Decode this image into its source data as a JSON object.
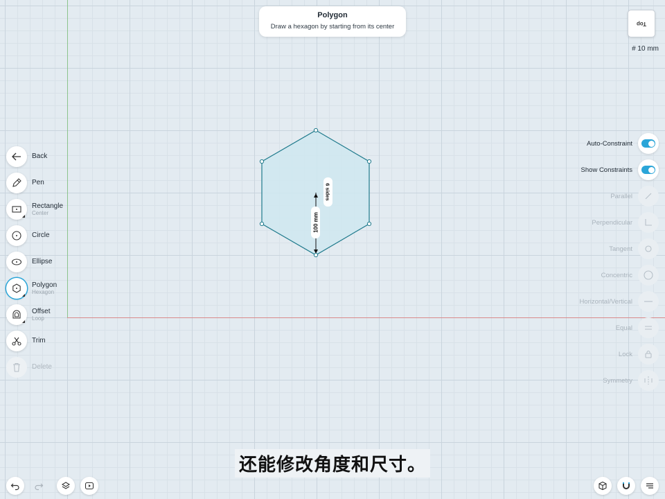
{
  "hint": {
    "title": "Polygon",
    "subtitle": "Draw a hexagon by starting from its center"
  },
  "viewcube": {
    "label": "Top"
  },
  "grid_size": "# 10 mm",
  "tools": [
    {
      "label": "Back",
      "icon": "back-arrow-icon"
    },
    {
      "label": "Pen",
      "icon": "pen-icon"
    },
    {
      "label": "Rectangle",
      "sublabel": "Center",
      "icon": "rectangle-icon"
    },
    {
      "label": "Circle",
      "icon": "circle-icon"
    },
    {
      "label": "Ellipse",
      "icon": "ellipse-icon"
    },
    {
      "label": "Polygon",
      "sublabel": "Hexagon",
      "icon": "polygon-icon",
      "active": true
    },
    {
      "label": "Offset",
      "sublabel": "Loop",
      "icon": "offset-icon"
    },
    {
      "label": "Trim",
      "icon": "trim-icon"
    },
    {
      "label": "Delete",
      "icon": "trash-icon",
      "disabled": true
    }
  ],
  "constraints": [
    {
      "label": "Auto-Constraint",
      "toggle": true,
      "on": true
    },
    {
      "label": "Show Constraints",
      "toggle": true,
      "on": true
    },
    {
      "label": "Parallel",
      "icon": "parallel-icon"
    },
    {
      "label": "Perpendicular",
      "icon": "perpendicular-icon"
    },
    {
      "label": "Tangent",
      "icon": "tangent-icon"
    },
    {
      "label": "Concentric",
      "icon": "concentric-icon"
    },
    {
      "label": "Horizontal/Vertical",
      "icon": "horizontal-vertical-icon"
    },
    {
      "label": "Equal",
      "icon": "equal-icon"
    },
    {
      "label": "Lock",
      "icon": "lock-icon"
    },
    {
      "label": "Symmetry",
      "icon": "symmetry-icon"
    }
  ],
  "sketch": {
    "dimension": "100 mm",
    "sides": "6 sides"
  },
  "subtitle": "还能修改角度和尺寸。",
  "bottom_left": [
    "undo-icon",
    "redo-icon",
    "layers-icon",
    "play-icon"
  ],
  "bottom_right": [
    "cube-view-icon",
    "magnet-icon",
    "menu-icon"
  ],
  "colors": {
    "accent": "#2aa5d8",
    "shape_fill": "#cfe8f0",
    "shape_stroke": "#1f7a8c",
    "x_axis": "#d98a8a",
    "y_axis": "#8cc48c"
  }
}
